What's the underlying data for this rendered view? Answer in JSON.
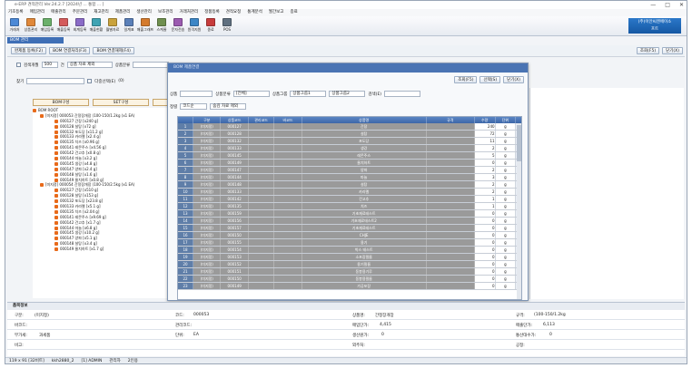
{
  "window": {
    "title": "e-ERP 견적관리 Ver.24.2.7 [2024년 ... 통합 ... ]",
    "ctl_min": "—",
    "ctl_max": "□",
    "ctl_close": "✕"
  },
  "menu": [
    "기초등록",
    "매입관리",
    "매출관리",
    "주문관리",
    "재고관리",
    "제품관리",
    "생산관리",
    "보조관리",
    "거래처관리",
    "정품등록",
    "견적요청",
    "통계분석",
    "월간보고",
    "종료"
  ],
  "toolbar": [
    {
      "label": "거래처",
      "color": "#4c89d6"
    },
    {
      "label": "상품관리",
      "color": "#e0883a"
    },
    {
      "label": "매입등록",
      "color": "#6bb06b"
    },
    {
      "label": "매출등록",
      "color": "#d45b5b"
    },
    {
      "label": "회계등록",
      "color": "#8a6bc7"
    },
    {
      "label": "매출현황",
      "color": "#3fa3b3"
    },
    {
      "label": "월별자료",
      "color": "#c9a23c"
    },
    {
      "label": "일계표",
      "color": "#5a7fb8"
    },
    {
      "label": "매출그래프",
      "color": "#d47b2e"
    },
    {
      "label": "스케줄",
      "color": "#6f8f4f"
    },
    {
      "label": "문자전송",
      "color": "#9b5bb0"
    },
    {
      "label": "원격지원",
      "color": "#3c86c6"
    },
    {
      "label": "종료",
      "color": "#c73c3c"
    },
    {
      "label": "POS",
      "color": "#607080"
    }
  ],
  "brand": {
    "line1": "(주)이안씨엔에이소",
    "line2": "프트"
  },
  "doc_tab": "BOM 관리",
  "bom_toolbar": {
    "btn_register": "완제품 등록(F2)",
    "btn_link": "BOM 연결처리(F3)",
    "btn_unlink": "BOM 연결해제(F4)",
    "btn_search": "조회(F5)",
    "btn_close": "닫기(X)"
  },
  "filter1": {
    "check_label": "검색개월",
    "months": "500",
    "unit": "건",
    "option": "상품 자료 제외",
    "level_label": "상품분류"
  },
  "filter2": {
    "find_label": "찾기",
    "find_value": "",
    "option": "다중선택(E)",
    "extra": "(0)"
  },
  "subtabs": [
    "BOM구성",
    "SET구성",
    "BOM"
  ],
  "tree": {
    "root": "BOM ROOT",
    "items": [
      "[미지정] 000053 간정장개장 (100-150/1.2kg )x1 EA)",
      "000127 간장 [x240 g]",
      "000128 설탕 [x72 g]",
      "000132 포도당 [x11.2 g]",
      "000133 카라멜 [x2.4 g]",
      "000135 치즈 [x0.96 g]",
      "000141 레몬주스 [x4.56 g]",
      "000142 건고추 [x0.8 g]",
      "000144 마늘 [x3.2 g]",
      "000145 생강 [x4.8 g]",
      "000147 양파 [x2.4 g]",
      "000148 설탕 [x1.6 g]",
      "000149 물치하트 [x0.8 g]",
      "[미지정] 000054 간정장개장 (100-150/2.5kg )x1 EA)",
      "000127 간장 [x510 g]",
      "000128 설탕 [x153 g]",
      "000132 포도당 [x23.8 g]",
      "000133 카라멜 [x5.1 g]",
      "000135 치즈 [x2.04 g]",
      "000141 레몬주스 [x9.69 g]",
      "000142 건고추 [x1.7 g]",
      "000144 마늘 [x6.8 g]",
      "000145 생강 [x10.2 g]",
      "000147 양파 [x5.1 g]",
      "000148 설탕 [x3.4 g]",
      "000149 물치하트 [x1.7 g]"
    ]
  },
  "dialog": {
    "title": "BOM 제품연결",
    "btn_search": "조회(F5)",
    "btn_select": "선택(S)",
    "btn_close": "닫기(X)",
    "filter": {
      "product_label": "상품",
      "product_value": "",
      "class_label": "상품분류",
      "class_value": "[전체]",
      "group_label": "상품그룹",
      "group1": "상품그룹1",
      "group2": "상품그룹2",
      "search_label": "검색(E)",
      "search_value": "",
      "pos_label": "정렬",
      "pos_value": "코드순",
      "option": "숨김 자료 제외"
    },
    "columns": [
      "",
      "구분",
      "상품코드",
      "관리코드",
      "바코드",
      "상품명",
      "규격",
      "수량",
      "단위"
    ],
    "rows": [
      {
        "no": "1",
        "type": "(미지정)",
        "code": "000127",
        "name": "간장",
        "qty": "240",
        "unit": "g"
      },
      {
        "no": "2",
        "type": "(미지정)",
        "code": "000128",
        "name": "설탕",
        "qty": "72",
        "unit": "g"
      },
      {
        "no": "3",
        "type": "(미지정)",
        "code": "000132",
        "name": "포도당",
        "qty": "11",
        "unit": "g"
      },
      {
        "no": "4",
        "type": "(미지정)",
        "code": "000133",
        "name": "생강",
        "qty": "2",
        "unit": "g"
      },
      {
        "no": "5",
        "type": "(미지정)",
        "code": "000145",
        "name": "레몬주스",
        "qty": "5",
        "unit": "g"
      },
      {
        "no": "6",
        "type": "(미지정)",
        "code": "000149",
        "name": "물치하트",
        "qty": "0",
        "unit": "g"
      },
      {
        "no": "7",
        "type": "(미지정)",
        "code": "000147",
        "name": "양파",
        "qty": "2",
        "unit": "g"
      },
      {
        "no": "8",
        "type": "(미지정)",
        "code": "000144",
        "name": "마늘",
        "qty": "3",
        "unit": "g"
      },
      {
        "no": "9",
        "type": "(미지정)",
        "code": "000148",
        "name": "설탕",
        "qty": "2",
        "unit": "g"
      },
      {
        "no": "10",
        "type": "(미지정)",
        "code": "000133",
        "name": "카라멜",
        "qty": "2",
        "unit": "g"
      },
      {
        "no": "11",
        "type": "(미지정)",
        "code": "000142",
        "name": "건고추",
        "qty": "1",
        "unit": "g"
      },
      {
        "no": "12",
        "type": "(미지정)",
        "code": "000135",
        "name": "치즈",
        "qty": "1",
        "unit": "g"
      },
      {
        "no": "13",
        "type": "(미지정)",
        "code": "000159",
        "name": "기초재료테스트",
        "qty": "0",
        "unit": "g"
      },
      {
        "no": "14",
        "type": "(미지정)",
        "code": "000156",
        "name": "기초재료테스트2",
        "qty": "0",
        "unit": "g"
      },
      {
        "no": "15",
        "type": "(미지정)",
        "code": "000157",
        "name": "기초재료테스트",
        "qty": "0",
        "unit": "g"
      },
      {
        "no": "16",
        "type": "(미지정)",
        "code": "000150",
        "name": "CHJE",
        "qty": "0",
        "unit": "g"
      },
      {
        "no": "17",
        "type": "(미지정)",
        "code": "000155",
        "name": "용기",
        "qty": "0",
        "unit": "g"
      },
      {
        "no": "18",
        "type": "(미지정)",
        "code": "000154",
        "name": "박스 테스트",
        "qty": "0",
        "unit": "g"
      },
      {
        "no": "19",
        "type": "(미지정)",
        "code": "000153",
        "name": "소포장필름",
        "qty": "0",
        "unit": "g"
      },
      {
        "no": "20",
        "type": "(미지정)",
        "code": "000152",
        "name": "용기필름",
        "qty": "0",
        "unit": "g"
      },
      {
        "no": "21",
        "type": "(미지정)",
        "code": "000151",
        "name": "동봉용기루",
        "qty": "0",
        "unit": "g"
      },
      {
        "no": "22",
        "type": "(미지정)",
        "code": "000150",
        "name": "동봉용필름",
        "qty": "0",
        "unit": "g"
      },
      {
        "no": "23",
        "type": "(미지정)",
        "code": "000149",
        "name": "가공포장",
        "qty": "0",
        "unit": "g"
      }
    ]
  },
  "info": {
    "header": "품목정보",
    "type_label": "구분:",
    "type_value": "(미지정)",
    "code_label": "코드:",
    "code_value": "000053",
    "name_label": "상품명:",
    "name_value": "간정장개장",
    "spec_label": "규격:",
    "spec_value": "(100-150/1.2kg",
    "barcode_label": "바코드:",
    "mgmt_label": "관리코드:",
    "buy_label": "매입단가:",
    "buy_value": "4,415",
    "sell_label": "매출단가:",
    "sell_value": "6,113",
    "vat_label": "부가세:",
    "vat_value": "과세품",
    "unit_label": "단위:",
    "unit_value": "EA",
    "prod_label": "생산원가:",
    "prod_value": "0",
    "qty_label": "통산대수가:",
    "qty_value": "0",
    "note_label": "비고:",
    "ext_label": "외주처:",
    "supplier_label": "공정:"
  },
  "status": [
    "119 x 91 [32비트]",
    "kkh2880_2",
    "[1] ADMIN",
    "관리자",
    "2인용"
  ]
}
